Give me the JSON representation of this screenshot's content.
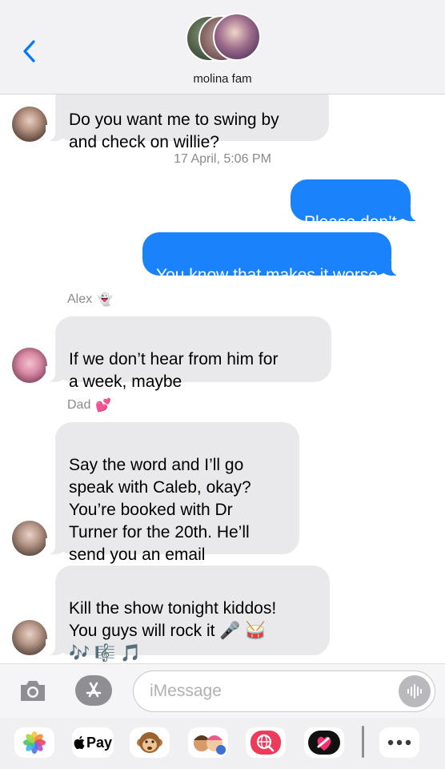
{
  "header": {
    "title": "molina fam",
    "back_icon": "chevron-left-icon"
  },
  "messages": {
    "msg1": "Do you want me to swing by\nand check on willie?",
    "timestamp": "17 April, 5:06 PM",
    "msg2": "Please don’t",
    "msg3": "You know that makes it worse",
    "alex_name": "Alex",
    "alex_emoji": "👻",
    "msg4": "If we don’t hear from him for\na week, maybe",
    "dad_name": "Dad",
    "dad_emoji": "💕",
    "msg5": "Say the word and I’ll go\nspeak with Caleb, okay?\nYou’re booked with Dr\nTurner for the 20th. He’ll\nsend you an email",
    "msg6": "Kill the show tonight kiddos!\nYou guys will rock it 🎤 🥁\n🎶 🎼 🎵"
  },
  "input": {
    "placeholder": "iMessage",
    "value": ""
  },
  "drawer": {
    "apple_pay_label": "Pay"
  },
  "colors": {
    "outgoing": "#1a82fb",
    "incoming": "#e9e9eb",
    "accent": "#007aff"
  }
}
